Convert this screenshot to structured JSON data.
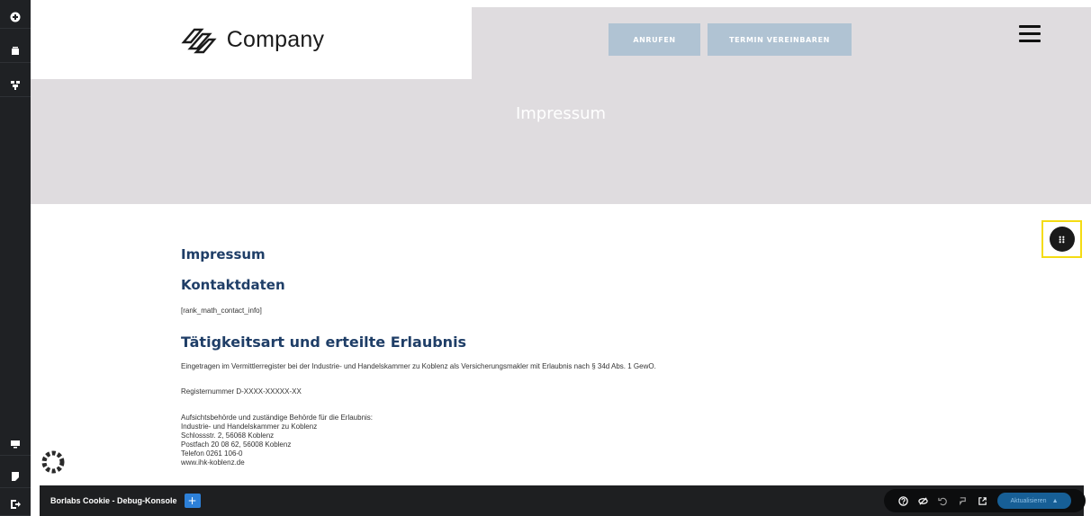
{
  "header": {
    "logo_text": "Company",
    "call_label": "ANRUFEN",
    "appointment_label": "TERMIN VEREINBAREN"
  },
  "hero": {
    "title": "Impressum"
  },
  "content": {
    "heading": "Impressum",
    "contact_heading": "Kontaktdaten",
    "contact_shortcode": "[rank_math_contact_info]",
    "activity_heading": "Tätigkeitsart und erteilte Erlaubnis",
    "registry_text": "Eingetragen im Vermittlerregister bei der Industrie- und Handelskammer zu Koblenz als Versicherungsmakler mit Erlaubnis nach § 34d Abs. 1 GewO.",
    "registry_number": "Registernummer D-XXXX-XXXXX-XX",
    "authority_lines": [
      "Aufsichtsbehörde und zuständige Behörde für die Erlaubnis:",
      "Industrie- und Handelskammer zu Koblenz",
      "Schlossstr. 2, 56068 Koblenz",
      "Postfach 20 08 62, 56008 Koblenz",
      "Telefon 0261 106-0",
      "www.ihk-koblenz.de"
    ]
  },
  "console": {
    "title": "Borlabs Cookie - Debug-Konsole",
    "add_label": "+",
    "update_label": "Aktualisieren"
  },
  "icons": {
    "rail": [
      "plus-circle-icon",
      "layers-icon",
      "navigator-icon",
      "responsive-icon",
      "notes-icon",
      "exit-icon"
    ],
    "tools": [
      "help-icon",
      "hide-icon",
      "undo-icon",
      "history-icon",
      "external-link-icon"
    ]
  },
  "colors": {
    "hero_bg": "#dfdcdf",
    "heading_blue": "#1f3e67",
    "cta_bg": "#b0c3d3",
    "highlight": "#f4dc13"
  }
}
